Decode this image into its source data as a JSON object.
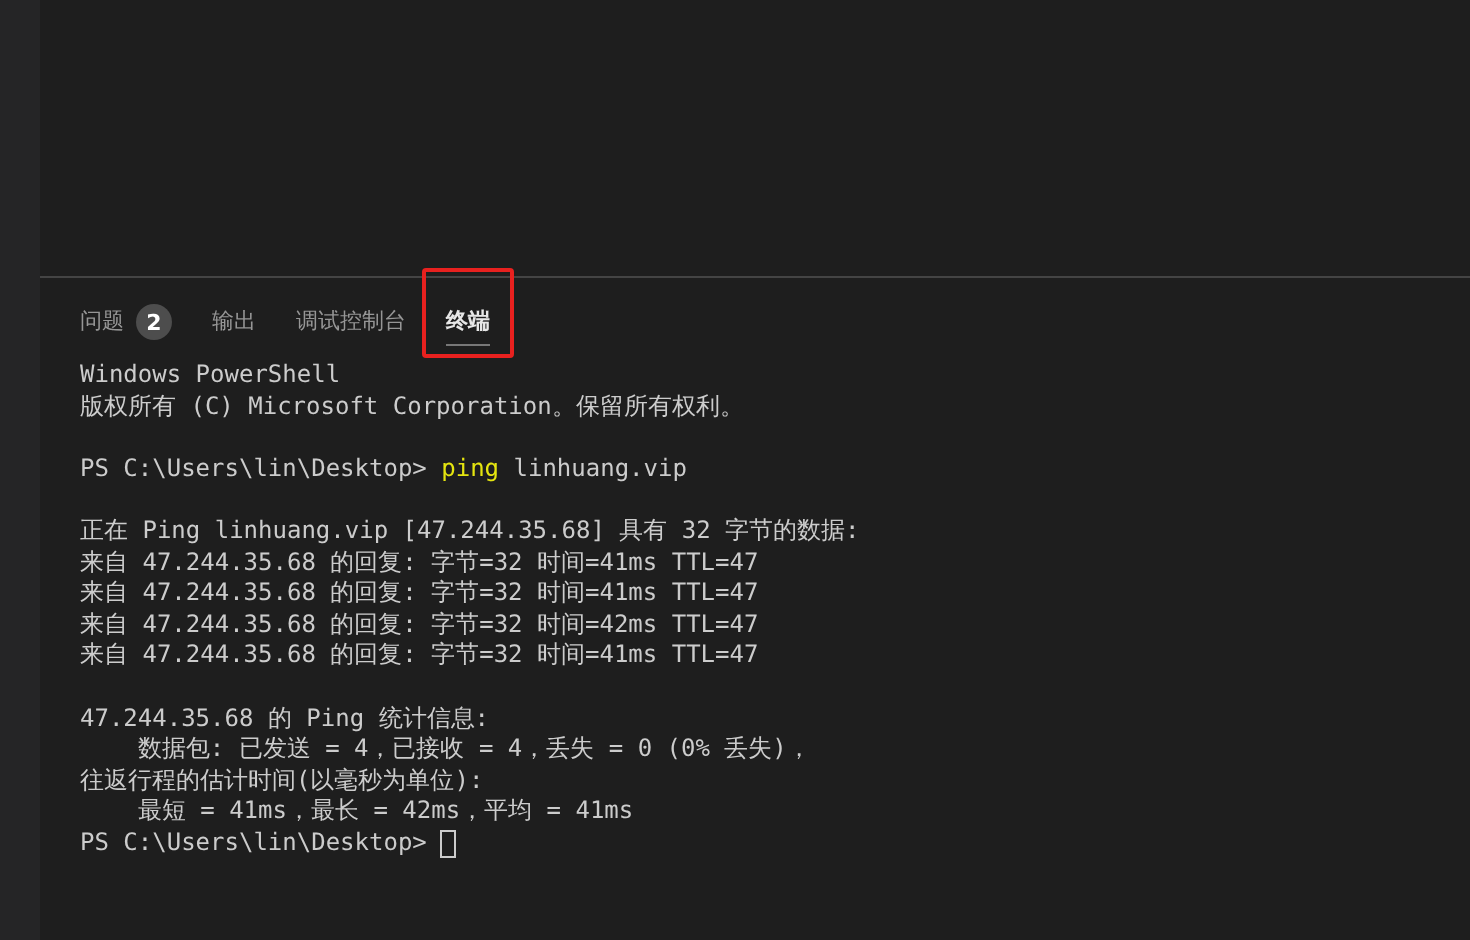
{
  "panel": {
    "tabs": [
      {
        "label": "问题",
        "badge": "2",
        "selected": false,
        "highlighted": false
      },
      {
        "label": "输出",
        "selected": false,
        "highlighted": false
      },
      {
        "label": "调试控制台",
        "selected": false,
        "highlighted": false
      },
      {
        "label": "终端",
        "selected": true,
        "highlighted": true
      }
    ]
  },
  "terminal": {
    "lines": [
      {
        "kind": "text",
        "text": "Windows PowerShell"
      },
      {
        "kind": "text",
        "text": "版权所有 (C) Microsoft Corporation。保留所有权利。"
      },
      {
        "kind": "blank"
      },
      {
        "kind": "prompt",
        "prompt": "PS C:\\Users\\lin\\Desktop>",
        "command": "ping",
        "args": "linhuang.vip",
        "cursor": false
      },
      {
        "kind": "blank"
      },
      {
        "kind": "text",
        "text": "正在 Ping linhuang.vip [47.244.35.68] 具有 32 字节的数据:"
      },
      {
        "kind": "text",
        "text": "来自 47.244.35.68 的回复: 字节=32 时间=41ms TTL=47"
      },
      {
        "kind": "text",
        "text": "来自 47.244.35.68 的回复: 字节=32 时间=41ms TTL=47"
      },
      {
        "kind": "text",
        "text": "来自 47.244.35.68 的回复: 字节=32 时间=42ms TTL=47"
      },
      {
        "kind": "text",
        "text": "来自 47.244.35.68 的回复: 字节=32 时间=41ms TTL=47"
      },
      {
        "kind": "blank"
      },
      {
        "kind": "text",
        "text": "47.244.35.68 的 Ping 统计信息:"
      },
      {
        "kind": "text",
        "text": "    数据包: 已发送 = 4，已接收 = 4，丢失 = 0 (0% 丢失)，"
      },
      {
        "kind": "text",
        "text": "往返行程的估计时间(以毫秒为单位):"
      },
      {
        "kind": "text",
        "text": "    最短 = 41ms，最长 = 42ms，平均 = 41ms"
      },
      {
        "kind": "prompt",
        "prompt": "PS C:\\Users\\lin\\Desktop>",
        "cursor": true
      }
    ]
  }
}
